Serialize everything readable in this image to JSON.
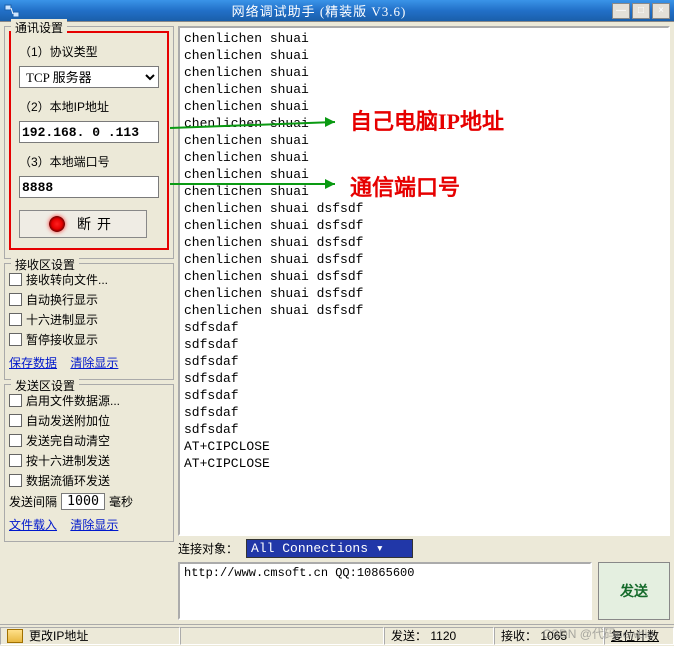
{
  "window": {
    "title": "网络调试助手  (精装版  V3.6)",
    "min": "—",
    "max": "□",
    "close": "×"
  },
  "comm": {
    "legend": "通讯设置",
    "label_protocol": "（1）协议类型",
    "protocol": "TCP 服务器",
    "label_ip": "（2）本地IP地址",
    "ip": "192.168. 0 .113",
    "label_port": "（3）本地端口号",
    "port": "8888",
    "disconnect": "断开"
  },
  "recv": {
    "legend": "接收区设置",
    "c1": "接收转向文件...",
    "c2": "自动换行显示",
    "c3": "十六进制显示",
    "c4": "暂停接收显示",
    "link_save": "保存数据",
    "link_clear": "清除显示"
  },
  "send": {
    "legend": "发送区设置",
    "c1": "启用文件数据源...",
    "c2": "自动发送附加位",
    "c3": "发送完自动清空",
    "c4": "按十六进制发送",
    "c5": "数据流循环发送",
    "interval_lbl": "发送间隔",
    "interval_val": "1000",
    "interval_unit": "毫秒",
    "link_load": "文件载入",
    "link_clear": "清除显示"
  },
  "log": "chenlichen shuai\nchenlichen shuai\nchenlichen shuai\nchenlichen shuai\nchenlichen shuai\nchenlichen shuai\nchenlichen shuai\nchenlichen shuai\nchenlichen shuai\nchenlichen shuai\nchenlichen shuai dsfsdf\nchenlichen shuai dsfsdf\nchenlichen shuai dsfsdf\nchenlichen shuai dsfsdf\nchenlichen shuai dsfsdf\nchenlichen shuai dsfsdf\nchenlichen shuai dsfsdf\nsdfsdaf\nsdfsdaf\nsdfsdaf\nsdfsdaf\nsdfsdaf\nsdfsdaf\nsdfsdaf\nAT+CIPCLOSE\nAT+CIPCLOSE",
  "conn": {
    "label": "连接对象：",
    "value": "All Connections"
  },
  "sendbox": {
    "text": "http://www.cmsoft.cn QQ:10865600",
    "btn": "发送"
  },
  "status": {
    "ip_change": "更改IP地址",
    "sent_lbl": "发送：",
    "sent_val": "1120",
    "recv_lbl": "接收：",
    "recv_val": "1065",
    "reset": "复位计数"
  },
  "annot": {
    "ip": "自己电脑IP地址",
    "port": "通信端口号"
  },
  "watermark": "CSDN @代码newbie"
}
